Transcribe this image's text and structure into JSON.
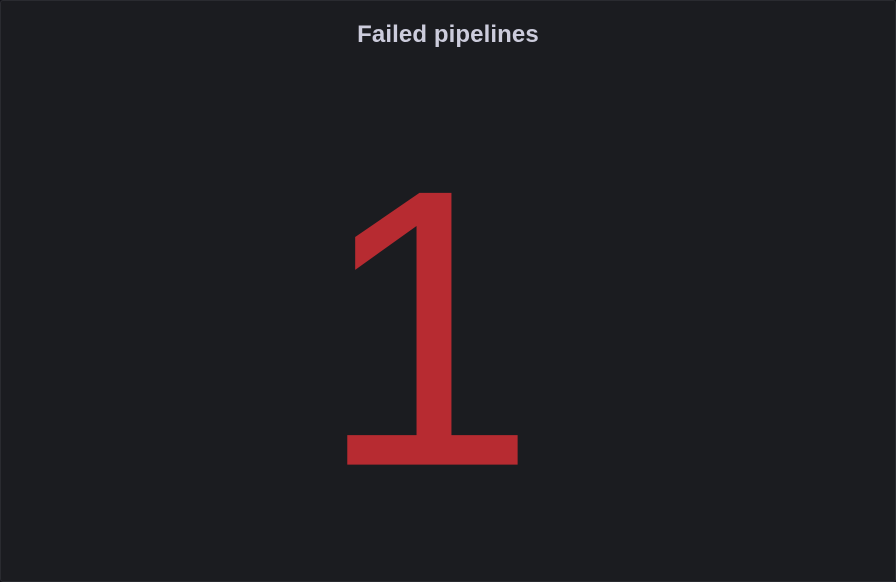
{
  "panel": {
    "title": "Failed pipelines",
    "value": "1",
    "value_color": "#b72b31",
    "title_color": "#ccccdc",
    "background_color": "#1b1c20"
  }
}
